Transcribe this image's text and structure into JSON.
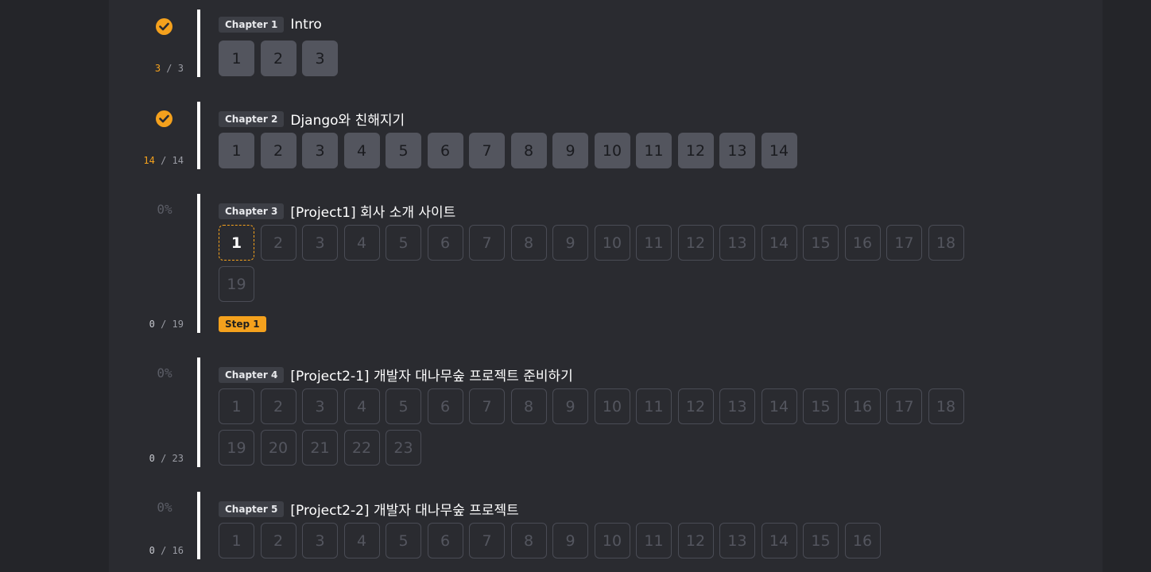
{
  "chapters": [
    {
      "badge": "Chapter 1",
      "title": "Intro",
      "completed": true,
      "percent": null,
      "done_count": "3",
      "total_count": "3",
      "steps": [
        "1",
        "2",
        "3"
      ],
      "done_steps": 3,
      "current_step": null,
      "current_label": null
    },
    {
      "badge": "Chapter 2",
      "title": "Django와 친해지기",
      "completed": true,
      "percent": null,
      "done_count": "14",
      "total_count": "14",
      "steps": [
        "1",
        "2",
        "3",
        "4",
        "5",
        "6",
        "7",
        "8",
        "9",
        "10",
        "11",
        "12",
        "13",
        "14"
      ],
      "done_steps": 14,
      "current_step": null,
      "current_label": null
    },
    {
      "badge": "Chapter 3",
      "title": "[Project1] 회사 소개 사이트",
      "completed": false,
      "percent": "0%",
      "done_count": "0",
      "total_count": "19",
      "steps": [
        "1",
        "2",
        "3",
        "4",
        "5",
        "6",
        "7",
        "8",
        "9",
        "10",
        "11",
        "12",
        "13",
        "14",
        "15",
        "16",
        "17",
        "18",
        "19"
      ],
      "done_steps": 0,
      "current_step": 0,
      "current_label": "Step 1"
    },
    {
      "badge": "Chapter 4",
      "title": "[Project2-1] 개발자 대나무숲 프로젝트 준비하기",
      "completed": false,
      "percent": "0%",
      "done_count": "0",
      "total_count": "23",
      "steps": [
        "1",
        "2",
        "3",
        "4",
        "5",
        "6",
        "7",
        "8",
        "9",
        "10",
        "11",
        "12",
        "13",
        "14",
        "15",
        "16",
        "17",
        "18",
        "19",
        "20",
        "21",
        "22",
        "23"
      ],
      "done_steps": 0,
      "current_step": null,
      "current_label": null
    },
    {
      "badge": "Chapter 5",
      "title": "[Project2-2] 개발자 대나무숲 프로젝트",
      "completed": false,
      "percent": "0%",
      "done_count": "0",
      "total_count": "16",
      "steps": [
        "1",
        "2",
        "3",
        "4",
        "5",
        "6",
        "7",
        "8",
        "9",
        "10",
        "11",
        "12",
        "13",
        "14",
        "15",
        "16"
      ],
      "done_steps": 0,
      "current_step": null,
      "current_label": null
    }
  ],
  "count_separator": "/",
  "colors": {
    "accent": "#f4a11d",
    "done_step": "#53555e",
    "background": "#2a2b30"
  }
}
